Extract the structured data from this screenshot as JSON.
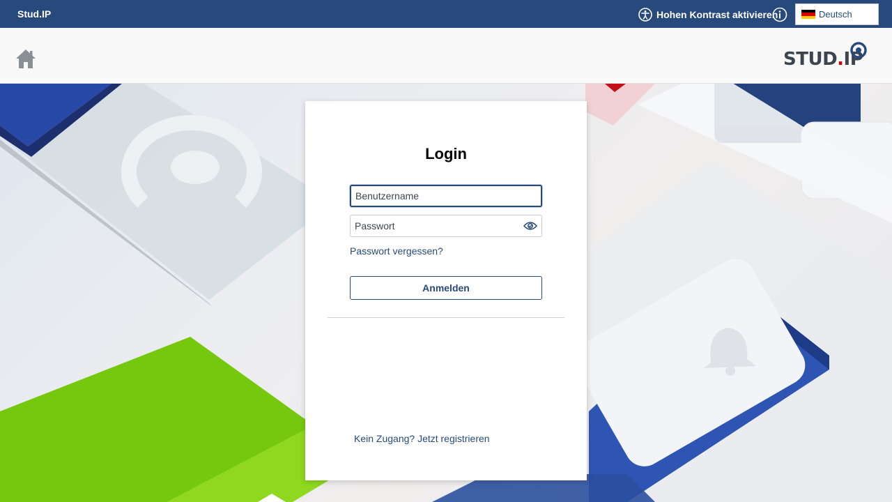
{
  "topbar": {
    "site_name": "Stud.IP",
    "contrast_label": "Hohen Kontrast aktivieren",
    "language": "Deutsch"
  },
  "header": {
    "logo_text_main": "STUD",
    "logo_text_dot": ".",
    "logo_text_end": "IP"
  },
  "login": {
    "title": "Login",
    "username_placeholder": "Benutzername",
    "password_placeholder": "Passwort",
    "forgot_label": "Passwort vergessen?",
    "submit_label": "Anmelden",
    "register_label": "Kein Zugang? Jetzt registrieren"
  },
  "colors": {
    "brand_blue": "#28497c",
    "accent_red": "#d60000",
    "accent_green": "#72c411"
  },
  "icons": {
    "accessibility": "accessibility-icon",
    "info": "info-icon",
    "home": "home-icon",
    "eye": "eye-icon",
    "flag": "german-flag-icon"
  }
}
